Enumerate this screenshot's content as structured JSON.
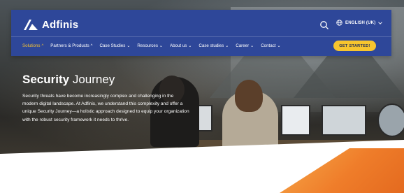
{
  "brand": {
    "name": "Adfinis"
  },
  "header": {
    "language_label": "ENGLISH (UK)",
    "icons": {
      "search": "search-icon",
      "globe": "globe-icon",
      "chevron": "chevron-down-icon"
    }
  },
  "nav": {
    "items": [
      {
        "label": "Solutions",
        "active": true
      },
      {
        "label": "Partners & Products"
      },
      {
        "label": "Case Studies"
      },
      {
        "label": "Resources"
      },
      {
        "label": "About us"
      },
      {
        "label": "Case studies"
      },
      {
        "label": "Career"
      },
      {
        "label": "Contact"
      }
    ],
    "cta_label": "GET STARTED!"
  },
  "hero": {
    "title_bold": "Security",
    "title_light": "Journey",
    "description": "Security threats have become increasingly complex and challenging in the modern digital landscape. At Adfinis, we understand this complexity and offer a unique Security Journey—a holistic approach designed to equip your organization with the robust security framework it needs to thrive."
  },
  "colors": {
    "nav_bg": "#2e4799",
    "accent": "#f7c52e",
    "active_nav": "#f5c232",
    "orange": "#ef7d2a"
  }
}
